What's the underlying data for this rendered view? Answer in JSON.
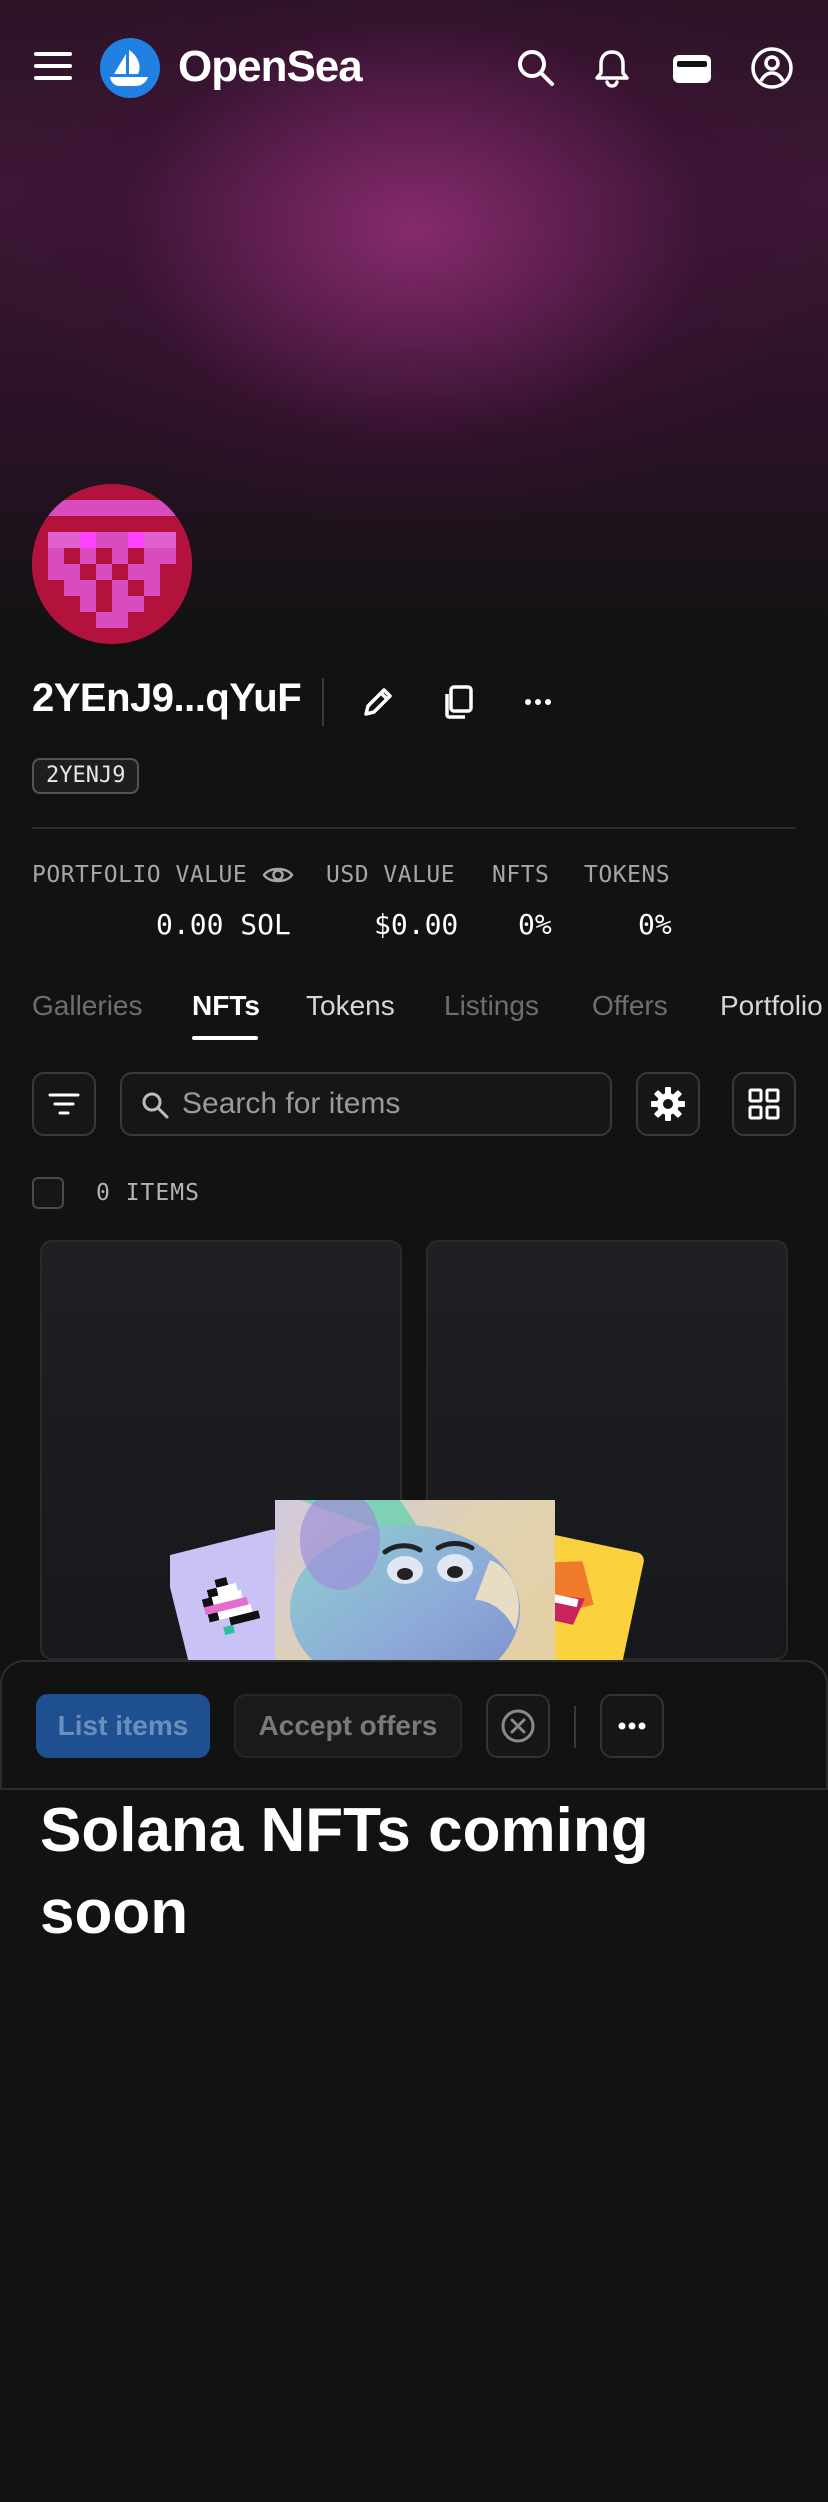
{
  "brand": {
    "name": "OpenSea",
    "accent": "#2081e2"
  },
  "nav": {
    "icons": [
      "menu-icon",
      "search-icon",
      "bell-icon",
      "wallet-icon",
      "account-icon"
    ]
  },
  "profile": {
    "display_name": "2YEnJ9...qYuF",
    "tag": "2YENJ9"
  },
  "stats": [
    {
      "label": "PORTFOLIO VALUE",
      "value": "0.00 SOL"
    },
    {
      "label": "USD VALUE",
      "value": "$0.00"
    },
    {
      "label": "NFTS",
      "value": "0%"
    },
    {
      "label": "TOKENS",
      "value": "0%"
    }
  ],
  "tabs": [
    {
      "label": "Galleries",
      "active": false
    },
    {
      "label": "NFTs",
      "active": true
    },
    {
      "label": "Tokens",
      "active": false
    },
    {
      "label": "Listings",
      "active": false
    },
    {
      "label": "Offers",
      "active": false
    },
    {
      "label": "Portfolio",
      "active": false
    }
  ],
  "toolbar": {
    "search_placeholder": "Search for items"
  },
  "items": {
    "count_label": "0 ITEMS"
  },
  "action_bar": {
    "list_items": "List items",
    "accept_offers": "Accept offers"
  },
  "empty_state": {
    "headline": "Solana NFTs coming soon"
  }
}
